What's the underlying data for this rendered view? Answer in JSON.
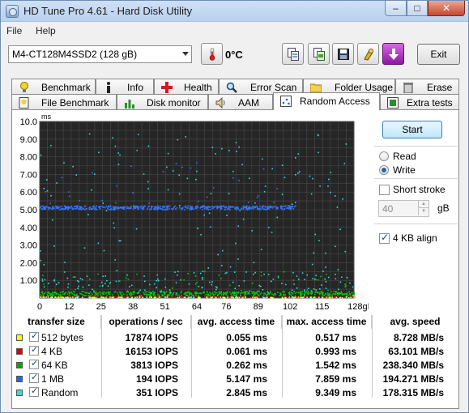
{
  "window": {
    "title": "HD Tune Pro 4.61 - Hard Disk Utility",
    "min": "–",
    "max": "□",
    "close": "✕"
  },
  "menu": [
    {
      "label": "File"
    },
    {
      "label": "Help"
    }
  ],
  "toolbar": {
    "drive": "M4-CT128M4SSD2 (128 gB)",
    "temperature": "0°C",
    "exit_label": "Exit",
    "icons": [
      "thermometer-icon",
      "copy-text-icon",
      "copy-screenshot-icon",
      "save-icon",
      "options-icon",
      "download-icon"
    ]
  },
  "tabs": {
    "row1": [
      "Benchmark",
      "Info",
      "Health",
      "Error Scan",
      "Folder Usage",
      "Erase"
    ],
    "row2": [
      "File Benchmark",
      "Disk monitor",
      "AAM",
      "Random Access",
      "Extra tests"
    ],
    "active": "Random Access"
  },
  "controls": {
    "start_label": "Start",
    "read_label": "Read",
    "write_label": "Write",
    "mode": "Write",
    "short_stroke_label": "Short stroke",
    "short_stroke_checked": false,
    "short_stroke_value": "40",
    "short_stroke_unit": "gB",
    "align_label": "4 KB align",
    "align_checked": true
  },
  "chart_data": {
    "type": "scatter",
    "ylabel": "ms",
    "xlabel": "gB",
    "ylim": [
      0,
      10
    ],
    "xlim": [
      0,
      128
    ],
    "y_ticks": [
      "10.0",
      "9.00",
      "8.00",
      "7.00",
      "6.00",
      "5.00",
      "4.00",
      "3.00",
      "2.00",
      "1.00"
    ],
    "x_ticks": [
      "0",
      "12",
      "25",
      "38",
      "51",
      "64",
      "76",
      "89",
      "102",
      "115",
      "128gB"
    ],
    "x_tick_values": [
      0,
      12,
      25,
      38,
      51,
      64,
      76,
      89,
      102,
      115,
      128
    ],
    "grid": true,
    "series": [
      {
        "name": "512 bytes",
        "color": "#ffff00",
        "typical_ms": 0.055,
        "max_ms": 0.517
      },
      {
        "name": "4 KB",
        "color": "#ff0000",
        "typical_ms": 0.061,
        "max_ms": 0.993
      },
      {
        "name": "64 KB",
        "color": "#00cc00",
        "typical_ms": 0.262,
        "max_ms": 1.542
      },
      {
        "name": "1 MB",
        "color": "#3377ff",
        "typical_ms": 5.147,
        "max_ms": 7.859
      },
      {
        "name": "Random",
        "color": "#33dddd",
        "typical_ms": 2.845,
        "max_ms": 9.349
      }
    ]
  },
  "results": {
    "headers": [
      "transfer size",
      "operations / sec",
      "avg. access time",
      "max. access time",
      "avg. speed"
    ],
    "rows": [
      {
        "size": "512 bytes",
        "color": "#ffff00",
        "ops": "17874 IOPS",
        "avg": "0.055 ms",
        "max": "0.517 ms",
        "speed": "8.728 MB/s"
      },
      {
        "size": "4 KB",
        "color": "#dd0000",
        "ops": "16153 IOPS",
        "avg": "0.061 ms",
        "max": "0.993 ms",
        "speed": "63.101 MB/s"
      },
      {
        "size": "64 KB",
        "color": "#00aa00",
        "ops": "3813 IOPS",
        "avg": "0.262 ms",
        "max": "1.542 ms",
        "speed": "238.340 MB/s"
      },
      {
        "size": "1 MB",
        "color": "#2266ee",
        "ops": "194 IOPS",
        "avg": "5.147 ms",
        "max": "7.859 ms",
        "speed": "194.271 MB/s"
      },
      {
        "size": "Random",
        "color": "#33dddd",
        "ops": "351 IOPS",
        "avg": "2.845 ms",
        "max": "9.349 ms",
        "speed": "178.315 MB/s"
      }
    ]
  }
}
